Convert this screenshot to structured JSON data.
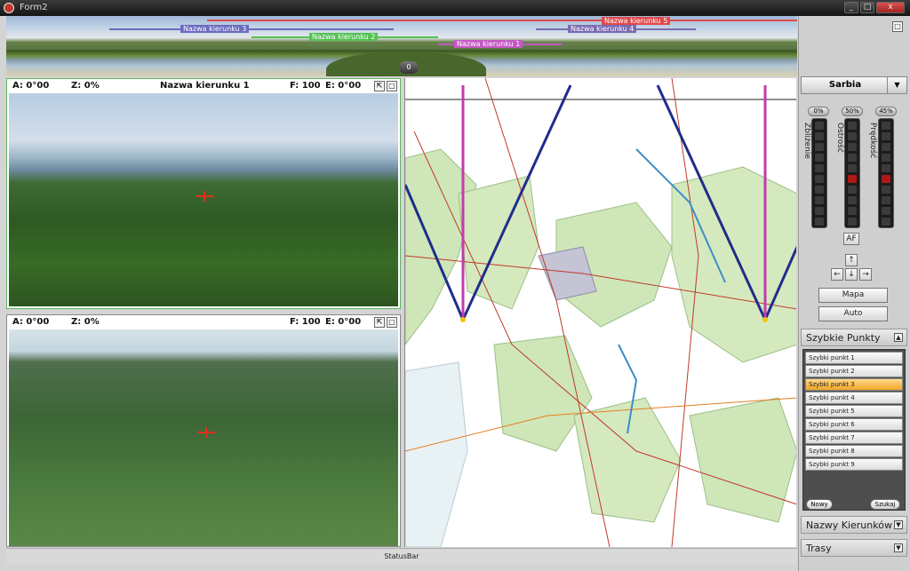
{
  "window": {
    "title": "Form2",
    "minimize": "_",
    "maximize": "□",
    "close": "x"
  },
  "panorama": {
    "counter": "0",
    "directions": [
      {
        "label": "Nazwa kierunku 5",
        "color": "#e04a4a"
      },
      {
        "label": "Nazwa kierunku 3",
        "color": "#6b6bbf"
      },
      {
        "label": "Nazwa kierunku 2",
        "color": "#55c255"
      },
      {
        "label": "Nazwa kierunku 1",
        "color": "#c458c4"
      },
      {
        "label": "Nazwa kierunku 4",
        "color": "#7a6bb0"
      }
    ]
  },
  "camera1": {
    "a": "A:  0°00",
    "z": "Z:  0%",
    "name": "Nazwa kierunku 1",
    "f": "F: 100",
    "e": "E:  0°00"
  },
  "camera2": {
    "a": "A:  0°00",
    "z": "Z:  0%",
    "name": "",
    "f": "F: 100",
    "e": "E:  0°00"
  },
  "sidebar": {
    "location": "Sarbia",
    "zoom": {
      "label": "Zbliżenie",
      "value": "0%"
    },
    "focus": {
      "label": "Ostrość",
      "value": "50%"
    },
    "speed": {
      "label": "Prędkość",
      "value": "45%"
    },
    "af_label": "AF",
    "map_button": "Mapa",
    "auto_button": "Auto",
    "quick_points_title": "Szybkie Punkty",
    "quick_points": [
      "Szybki punkt 1",
      "Szybki punkt 2",
      "Szybki punkt 3",
      "Szybki punkt 4",
      "Szybki punkt 5",
      "Szybki punkt 6",
      "Szybki punkt 7",
      "Szybki punkt 8",
      "Szybki punkt 9"
    ],
    "selected_index": 2,
    "new_button": "Nowy",
    "search_button": "Szukaj",
    "direction_names_title": "Nazwy Kierunków",
    "routes_title": "Trasy"
  },
  "statusbar": {
    "text": "StatusBar"
  }
}
